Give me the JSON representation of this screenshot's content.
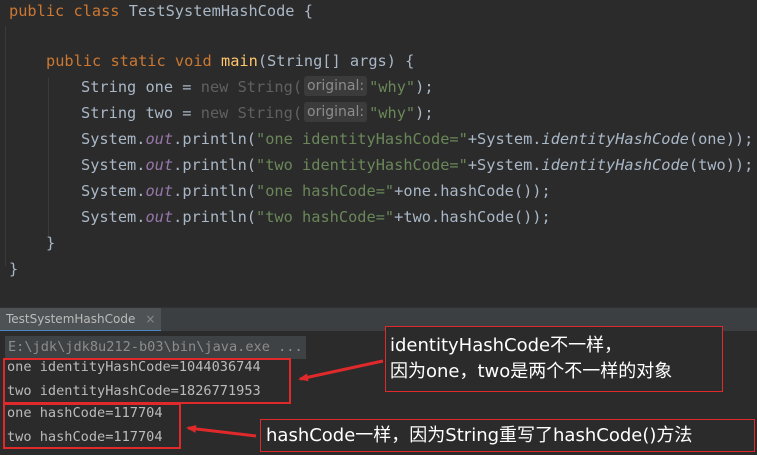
{
  "editor": {
    "lines": {
      "l1": {
        "kw": "public class ",
        "name": "TestSystemHashCode {"
      },
      "l3": {
        "kw1": "public static void ",
        "fn": "main",
        "rest": "(String[] args) {"
      },
      "l4": {
        "pre": "String one = ",
        "kw": "new ",
        "cls": "String(",
        "hint": "original:",
        "str": "\"why\"",
        "post": ");"
      },
      "l5": {
        "pre": "String two = ",
        "kw": "new ",
        "cls": "String(",
        "hint": "original:",
        "str": "\"why\"",
        "post": ");"
      },
      "l6": {
        "a": "System.",
        "b": "out",
        "c": ".println(",
        "s": "\"one identityHashCode=\"",
        "d": "+System.",
        "e": "identityHashCode",
        "f": "(one));"
      },
      "l7": {
        "a": "System.",
        "b": "out",
        "c": ".println(",
        "s": "\"two identityHashCode=\"",
        "d": "+System.",
        "e": "identityHashCode",
        "f": "(two));"
      },
      "l8": {
        "a": "System.",
        "b": "out",
        "c": ".println(",
        "s": "\"one hashCode=\"",
        "d": "+one.hashCode());"
      },
      "l9": {
        "a": "System.",
        "b": "out",
        "c": ".println(",
        "s": "\"two hashCode=\"",
        "d": "+two.hashCode());"
      },
      "l10": "}",
      "l11": "}"
    }
  },
  "run": {
    "tab_label": "TestSystemHashCode",
    "tab_close": "×",
    "command": "E:\\jdk\\jdk8u212-b03\\bin\\java.exe ...",
    "output": [
      "one identityHashCode=1044036744",
      "two identityHashCode=1826771953",
      "one hashCode=117704",
      "two hashCode=117704"
    ]
  },
  "annotations": {
    "note1_line1": "identityHashCode不一样，",
    "note1_line2": "因为one，two是两个不一样的对象",
    "note2": "hashCode一样，因为String重写了hashCode()方法",
    "color": "#e0292b"
  }
}
